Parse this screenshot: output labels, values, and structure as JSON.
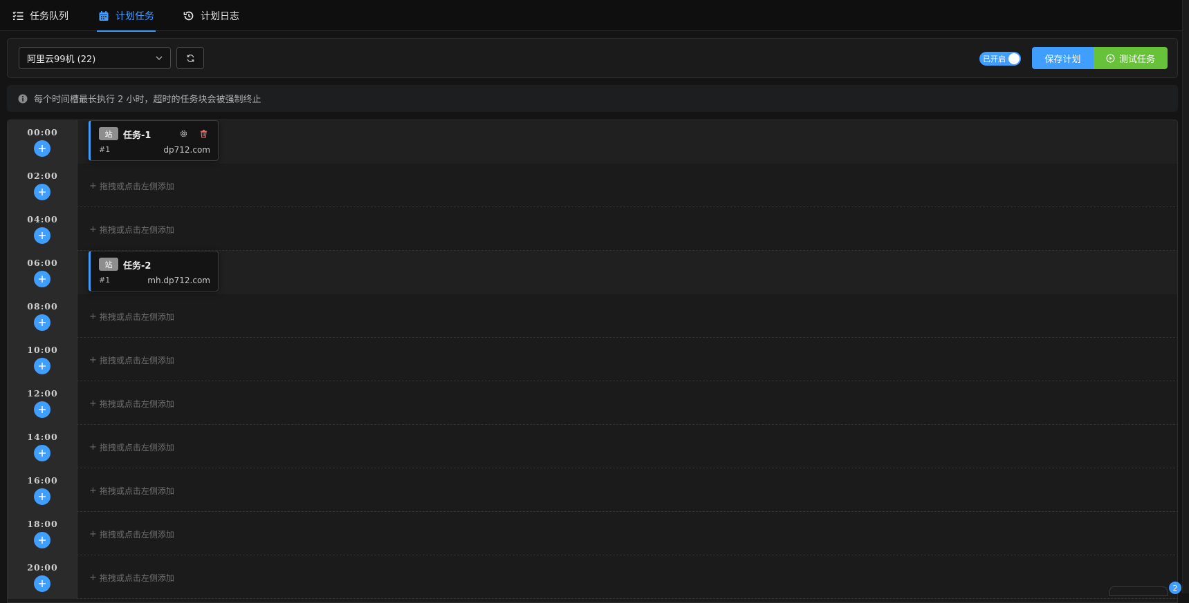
{
  "tabs": [
    {
      "label": "任务队列",
      "icon": "list-check-icon",
      "active": false
    },
    {
      "label": "计划任务",
      "icon": "calendar-icon",
      "active": true
    },
    {
      "label": "计划日志",
      "icon": "history-icon",
      "active": false
    }
  ],
  "toolbar": {
    "server_select": "阿里云99机 (22)",
    "switch_label": "已开启",
    "switch_on": true,
    "save_label": "保存计划",
    "test_label": "测试任务"
  },
  "info": {
    "text": "每个时间槽最长执行 2 小时，超时的任务块会被强制终止"
  },
  "placeholder": "拖拽或点击左侧添加",
  "slots": [
    {
      "time": "00:00",
      "task": {
        "badge": "站",
        "name": "任务-1",
        "index": "#1",
        "domain": "dp712.com",
        "show_actions": true
      }
    },
    {
      "time": "02:00",
      "task": null
    },
    {
      "time": "04:00",
      "task": null
    },
    {
      "time": "06:00",
      "task": {
        "badge": "站",
        "name": "任务-2",
        "index": "#1",
        "domain": "mh.dp712.com",
        "show_actions": false
      }
    },
    {
      "time": "08:00",
      "task": null
    },
    {
      "time": "10:00",
      "task": null
    },
    {
      "time": "12:00",
      "task": null
    },
    {
      "time": "14:00",
      "task": null
    },
    {
      "time": "16:00",
      "task": null
    },
    {
      "time": "18:00",
      "task": null
    },
    {
      "time": "20:00",
      "task": null
    }
  ],
  "corner_badge": "2",
  "colors": {
    "accent": "#409eff",
    "success": "#67c23a",
    "danger": "#f56c6c"
  }
}
